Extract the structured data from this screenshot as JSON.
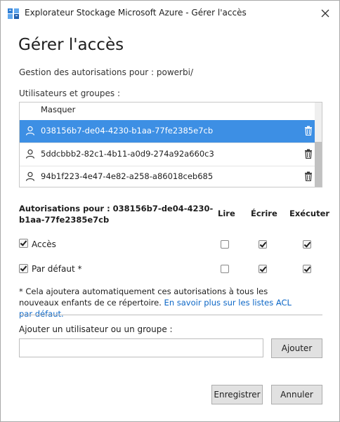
{
  "window": {
    "title": "Explorateur Stockage Microsoft Azure - Gérer l'accès",
    "app_icon": "azure-storage-explorer-icon",
    "close_icon": "close-icon"
  },
  "heading": "Gérer l'accès",
  "permissions_for": "Gestion des autorisations pour : powerbi/",
  "users_groups_label": "Utilisateurs et groupes :",
  "list": {
    "header": "Masquer",
    "items": [
      {
        "id": "038156b7-de04-4230-b1aa-77fe2385e7cb",
        "selected": true
      },
      {
        "id": "5ddcbbb2-82c1-4b11-a0d9-274a92a660c3",
        "selected": false
      },
      {
        "id": "94b1f223-4e47-4e82-a258-a86018ceb685",
        "selected": false
      }
    ]
  },
  "permissions": {
    "title": "Autorisations pour : 038156b7-de04-4230-b1aa-77fe2385e7cb",
    "columns": {
      "read": "Lire",
      "write": "Écrire",
      "execute": "Exécuter"
    },
    "rows": [
      {
        "label": "Accès",
        "enabled": true,
        "read": false,
        "write": true,
        "execute": true
      },
      {
        "label": "Par défaut *",
        "enabled": true,
        "read": false,
        "write": true,
        "execute": true
      }
    ]
  },
  "note": {
    "text": "* Cela ajoutera automatiquement ces autorisations à tous les nouveaux enfants de ce répertoire.",
    "link": "En savoir plus sur les listes ACL par défaut."
  },
  "add": {
    "label": "Ajouter un utilisateur ou un groupe :",
    "value": "",
    "button": "Ajouter"
  },
  "footer": {
    "save": "Enregistrer",
    "cancel": "Annuler"
  },
  "colors": {
    "selection": "#3d8fe4",
    "link": "#0b66c6"
  }
}
